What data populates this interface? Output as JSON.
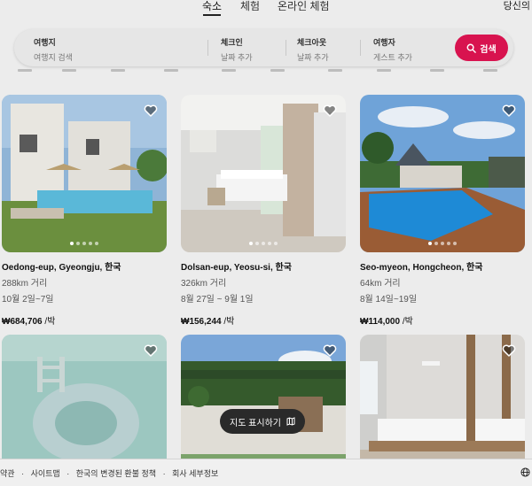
{
  "nav": {
    "tabs": [
      {
        "label": "숙소"
      },
      {
        "label": "체험"
      },
      {
        "label": "온라인 체험"
      }
    ],
    "profile_label": "당신의"
  },
  "search": {
    "where": {
      "label": "여행지",
      "placeholder": "여행지 검색"
    },
    "checkin": {
      "label": "체크인",
      "value": "날짜 추가"
    },
    "checkout": {
      "label": "체크아웃",
      "value": "날짜 추가"
    },
    "guests": {
      "label": "여행자",
      "value": "게스트 추가"
    },
    "button_label": "검색"
  },
  "listings": [
    {
      "location": "Oedong-eup, Gyeongju, 한국",
      "distance": "288km 거리",
      "dates": "10월 2일~7일",
      "price": "₩684,706",
      "price_unit": " /박"
    },
    {
      "location": "Dolsan-eup, Yeosu-si, 한국",
      "distance": "326km 거리",
      "dates": "8월 27일 ~ 9월 1일",
      "price": "₩156,244",
      "price_unit": " /박"
    },
    {
      "location": "Seo-myeon, Hongcheon, 한국",
      "distance": "64km 거리",
      "dates": "8월 14일~19일",
      "price": "₩114,000",
      "price_unit": " /박"
    },
    {
      "location": "",
      "distance": "",
      "dates": "",
      "price": "",
      "price_unit": ""
    },
    {
      "location": "",
      "distance": "",
      "dates": "",
      "price": "",
      "price_unit": ""
    },
    {
      "location": "",
      "distance": "",
      "dates": "",
      "price": "",
      "price_unit": ""
    }
  ],
  "map_button_label": "지도 표시하기",
  "footer": {
    "links": [
      "약관",
      "·",
      "사이트맵",
      "·",
      "한국의 변경된 환불 정책",
      "·",
      "회사 세부정보"
    ]
  },
  "colors": {
    "accent": "#d8134f"
  }
}
